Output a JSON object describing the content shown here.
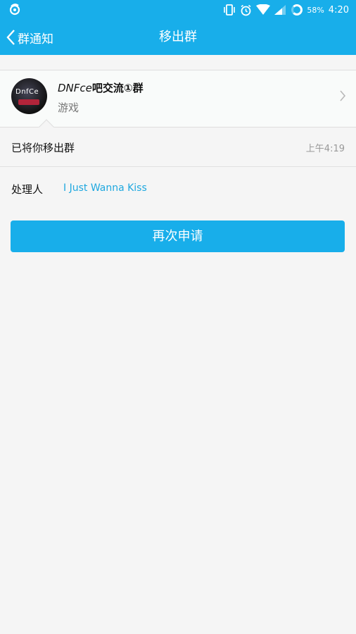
{
  "status_bar": {
    "battery": "58%",
    "time": "4:20"
  },
  "header": {
    "back_label": "群通知",
    "title": "移出群"
  },
  "group": {
    "name_prefix": "DNFce",
    "name_rest": "吧交流①群",
    "category": "游戏",
    "avatar_text": "DnfCe"
  },
  "notice": {
    "text": "已将你移出群",
    "time": "上午4:19"
  },
  "handler": {
    "label": "处理人",
    "name": "I Just Wanna Kiss"
  },
  "actions": {
    "reapply_label": "再次申请"
  },
  "colors": {
    "accent": "#18aeea",
    "link": "#1fa8df"
  }
}
